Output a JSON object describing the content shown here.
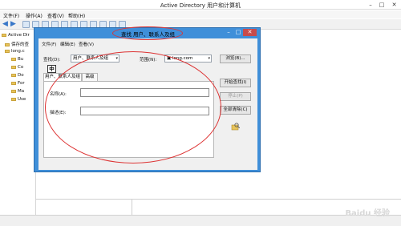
{
  "main_window": {
    "title": "Active Directory 用户和计算机",
    "menu": [
      "文件(F)",
      "操作(A)",
      "查看(V)",
      "帮助(H)"
    ],
    "tree": {
      "root": "Active Dir",
      "items": [
        {
          "label": "保存的查",
          "icon": "saved-query-icon"
        },
        {
          "label": "long.c",
          "icon": "domain-icon"
        },
        {
          "label": "Bu",
          "icon": "folder-icon"
        },
        {
          "label": "Co",
          "icon": "folder-icon"
        },
        {
          "label": "Do",
          "icon": "folder-icon"
        },
        {
          "label": "For",
          "icon": "folder-icon"
        },
        {
          "label": "Ma",
          "icon": "folder-icon"
        },
        {
          "label": "Use",
          "icon": "folder-icon"
        }
      ]
    }
  },
  "dialog": {
    "title": "查找 用户、联系人及组",
    "menu": [
      "文件(F)",
      "编辑(E)",
      "查看(V)"
    ],
    "find_label": "查找(D):",
    "find_value": "用户、联系人及组",
    "range_label": "范围(N):",
    "range_value": "long.com",
    "browse_button": "浏览(B)...",
    "tabs": [
      "用户、联系人及组",
      "高级"
    ],
    "name_label": "名称(A):",
    "description_label": "描述(E):",
    "ime_indicator": "中",
    "start_button": "开始查找(I)",
    "stop_button": "停止(P)",
    "clear_button": "全部清除(C)",
    "controls": {
      "minimize": "–",
      "maximize": "□",
      "close": "✕"
    }
  },
  "watermark": "Baidu 经验",
  "colors": {
    "dialog_frame": "#3f8fd9",
    "annotation": "#dd3333"
  }
}
